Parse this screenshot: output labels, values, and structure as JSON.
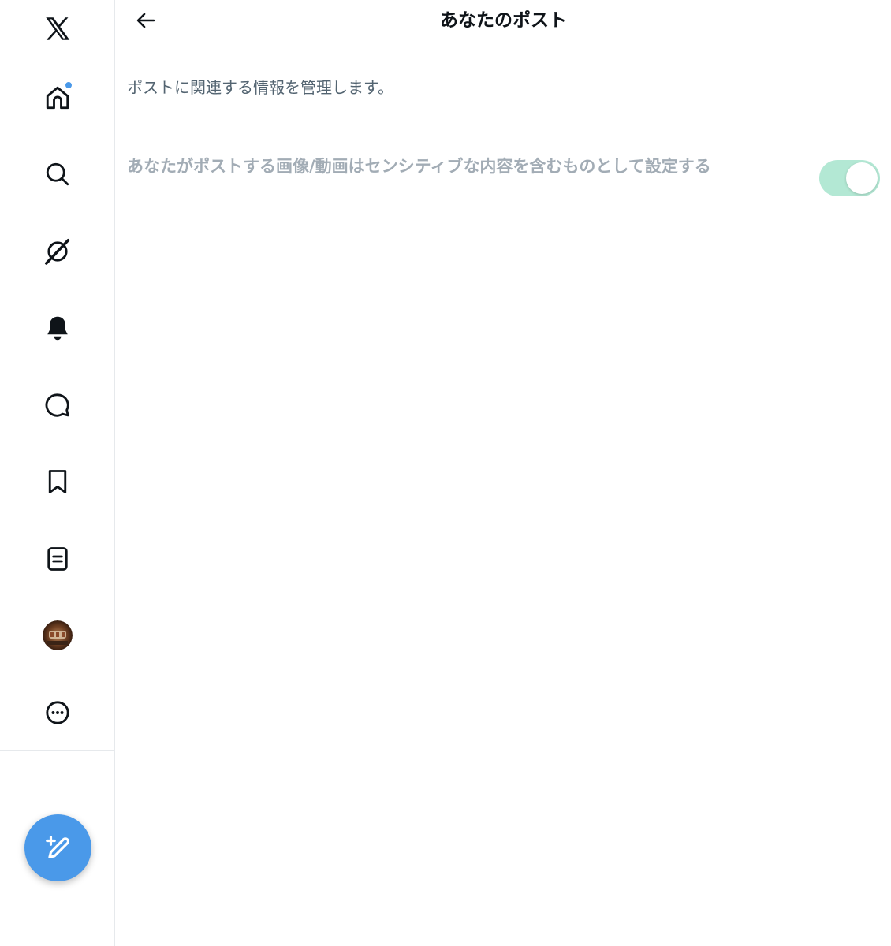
{
  "header": {
    "title": "あなたのポスト",
    "back_label": "←"
  },
  "main": {
    "description": "ポストに関連する情報を管理します。",
    "settings": [
      {
        "label": "あなたがポストする画像/動画はセンシティブな内容を含むものとして設定する",
        "enabled": true,
        "disabled_appearance": true
      }
    ]
  },
  "sidebar": {
    "items": [
      {
        "icon": "x-logo-icon"
      },
      {
        "icon": "home-icon",
        "has_notification": true
      },
      {
        "icon": "search-icon"
      },
      {
        "icon": "grok-icon"
      },
      {
        "icon": "bell-icon"
      },
      {
        "icon": "message-icon"
      },
      {
        "icon": "bookmark-icon"
      },
      {
        "icon": "lists-icon"
      },
      {
        "icon": "avatar"
      },
      {
        "icon": "more-icon"
      }
    ],
    "compose_icon": "compose-icon"
  },
  "colors": {
    "accent": "#4a99e9",
    "toggle_track": "#b3e8d4",
    "muted_text": "#a2acb5",
    "secondary_text": "#536471",
    "divider": "#e6e9ec"
  }
}
